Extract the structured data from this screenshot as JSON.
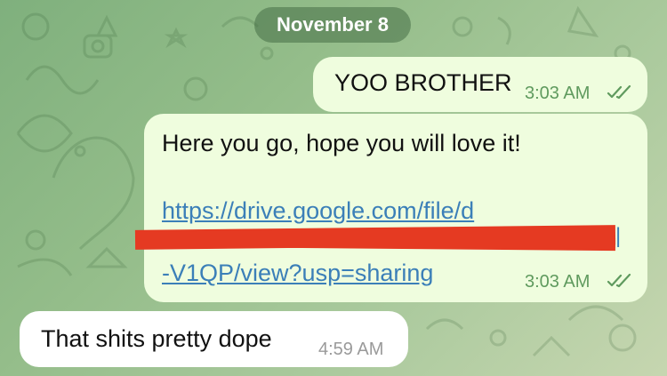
{
  "date_separator": "November 8",
  "messages": [
    {
      "direction": "outgoing",
      "text": "YOO BROTHER",
      "time": "3:03 AM",
      "status": "read"
    },
    {
      "direction": "outgoing",
      "text": "Here you go, hope you will love it!",
      "link_line1": "https://drive.google.com/file/d",
      "link_line3": "-V1QP/view?usp=sharing",
      "time": "3:03 AM",
      "status": "read"
    },
    {
      "direction": "incoming",
      "text": "That shits pretty dope",
      "time": "4:59 AM"
    }
  ],
  "icons": [
    "double-check-icon"
  ],
  "colors": {
    "outgoing_bubble": "#effdde",
    "incoming_bubble": "#ffffff",
    "link": "#3b7fb8",
    "redaction": "#e53a22",
    "wallpaper": "#8fbb86"
  }
}
